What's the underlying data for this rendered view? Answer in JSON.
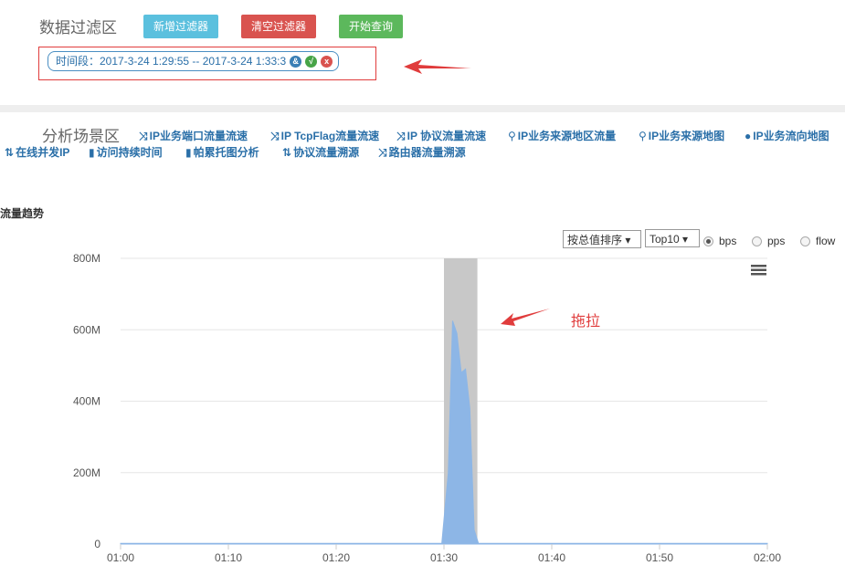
{
  "filter_section": {
    "title": "数据过滤区",
    "buttons": {
      "add": "新增过滤器",
      "clear": "清空过滤器",
      "query": "开始查询"
    },
    "active_filter": {
      "text": "时间段：2017-3-24 1:29:55 -- 2017-3-24 1:33:3"
    },
    "colors": {
      "add": "#5bc0de",
      "clear": "#d9534f",
      "query": "#5cb85c",
      "highlight_box": "#e03c3c"
    }
  },
  "analysis_section": {
    "title": "分析场景区",
    "links": [
      {
        "icon": "shuffle-icon",
        "glyph": "⤨",
        "label": "IP业务端口流量流速"
      },
      {
        "icon": "shuffle-icon",
        "glyph": "⤨",
        "label": "IP TcpFlag流量流速"
      },
      {
        "icon": "shuffle-icon",
        "glyph": "⤨",
        "label": "IP 协议流量流速"
      },
      {
        "icon": "map-marker-icon",
        "glyph": "⚲",
        "label": "IP业务来源地区流量"
      },
      {
        "icon": "map-marker-icon",
        "glyph": "⚲",
        "label": "IP业务来源地图"
      },
      {
        "icon": "globe-icon",
        "glyph": "●",
        "label": "IP业务流向地图"
      },
      {
        "icon": "sort-icon",
        "glyph": "⇅",
        "label": "在线并发IP"
      },
      {
        "icon": "bar-chart-icon",
        "glyph": "▮",
        "label": "访问持续时间"
      },
      {
        "icon": "bar-chart-icon",
        "glyph": "▮",
        "label": "帕累托图分析"
      },
      {
        "icon": "sort-icon",
        "glyph": "⇅",
        "label": "协议流量溯源"
      },
      {
        "icon": "shuffle-icon",
        "glyph": "⤨",
        "label": "路由器流量溯源"
      }
    ]
  },
  "chart_panel": {
    "title": "流量趋势",
    "sort_select": "按总值排序",
    "top_select": "Top10",
    "metrics": [
      {
        "label": "bps",
        "selected": true
      },
      {
        "label": "pps",
        "selected": false
      },
      {
        "label": "flow",
        "selected": false
      }
    ],
    "annotation": "拖拉"
  },
  "chart_data": {
    "type": "area",
    "y_ticks": [
      "0",
      "200M",
      "400M",
      "600M",
      "800M"
    ],
    "x_ticks": [
      "01:00",
      "01:10",
      "01:20",
      "01:30",
      "01:40",
      "01:50",
      "02:00"
    ],
    "ylim": [
      0,
      800
    ],
    "y_unit": "M",
    "x_minutes": [
      0,
      10,
      20,
      29.8,
      30.4,
      30.8,
      31.2,
      31.6,
      32.0,
      32.4,
      32.8,
      33.2,
      40,
      50,
      60
    ],
    "values": [
      2,
      2,
      2,
      2,
      200,
      625,
      590,
      480,
      490,
      380,
      40,
      2,
      2,
      2,
      2
    ],
    "selection_minutes": [
      30,
      33.1
    ],
    "series_color": "#8db6e6",
    "selection_color": "#c8c8c8",
    "grid": true
  }
}
